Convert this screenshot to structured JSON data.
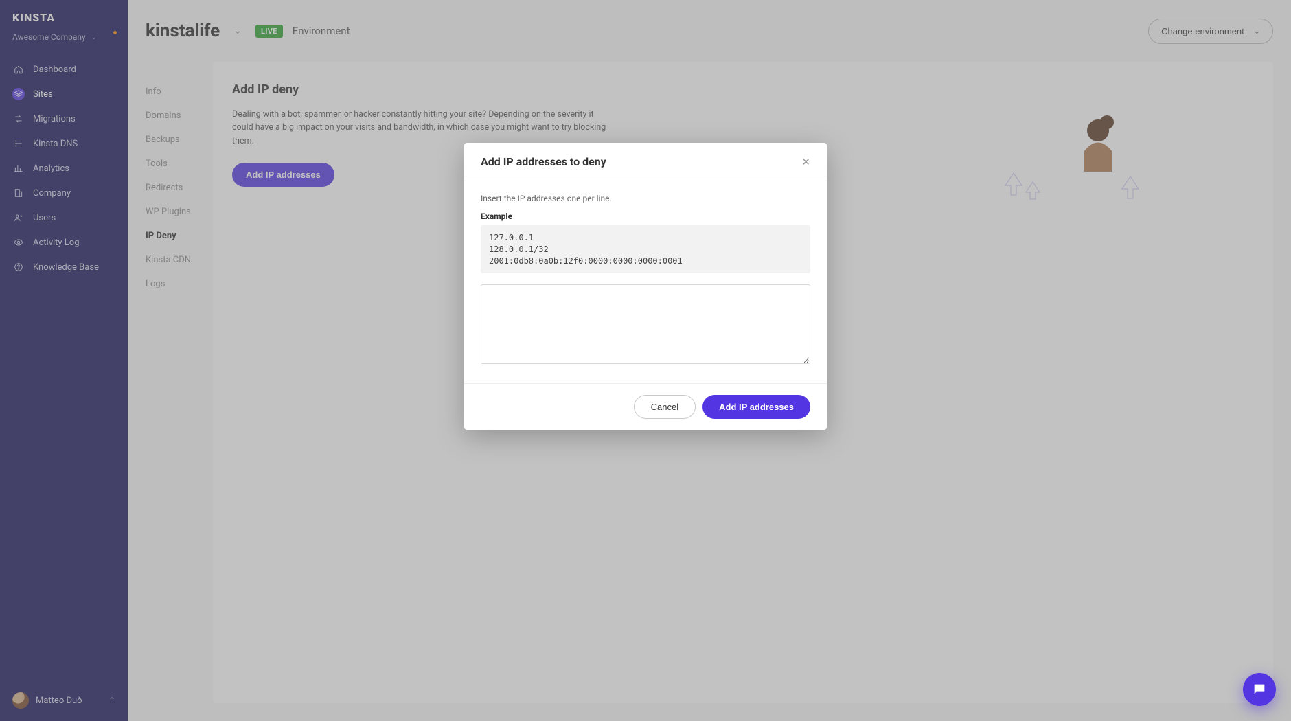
{
  "brand": "KINSTA",
  "company": {
    "name": "Awesome Company"
  },
  "nav": {
    "items": [
      {
        "label": "Dashboard"
      },
      {
        "label": "Sites"
      },
      {
        "label": "Migrations"
      },
      {
        "label": "Kinsta DNS"
      },
      {
        "label": "Analytics"
      },
      {
        "label": "Company"
      },
      {
        "label": "Users"
      },
      {
        "label": "Activity Log"
      },
      {
        "label": "Knowledge Base"
      }
    ],
    "active_index": 1
  },
  "user": {
    "name": "Matteo Duò"
  },
  "header": {
    "site": "kinstalife",
    "env_badge": "LIVE",
    "env_label": "Environment",
    "change_env": "Change environment"
  },
  "subnav": {
    "items": [
      {
        "label": "Info"
      },
      {
        "label": "Domains"
      },
      {
        "label": "Backups"
      },
      {
        "label": "Tools"
      },
      {
        "label": "Redirects"
      },
      {
        "label": "WP Plugins"
      },
      {
        "label": "IP Deny"
      },
      {
        "label": "Kinsta CDN"
      },
      {
        "label": "Logs"
      }
    ],
    "active_index": 6
  },
  "panel": {
    "title": "Add IP deny",
    "desc": "Dealing with a bot, spammer, or hacker constantly hitting your site? Depending on the severity it could have a big impact on your visits and bandwidth, in which case you might want to try blocking them.",
    "button": "Add IP addresses"
  },
  "modal": {
    "title": "Add IP addresses to deny",
    "hint": "Insert the IP addresses one per line.",
    "example_label": "Example",
    "example_text": "127.0.0.1\n128.0.0.1/32\n2001:0db8:0a0b:12f0:0000:0000:0000:0001",
    "textarea_value": "",
    "cancel": "Cancel",
    "confirm": "Add IP addresses"
  }
}
